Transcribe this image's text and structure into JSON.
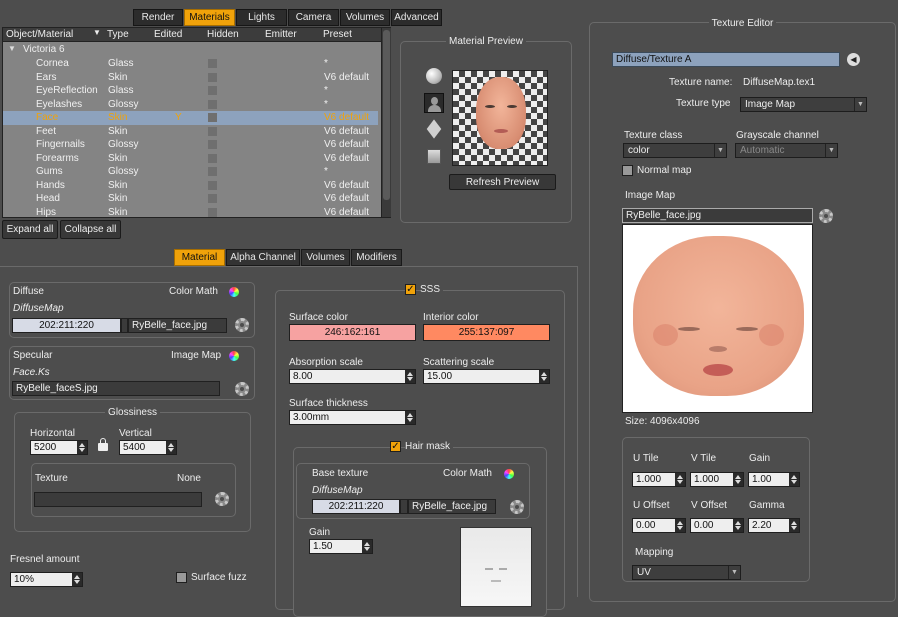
{
  "top_tabs": [
    "Render",
    "Materials",
    "Lights",
    "Camera",
    "Volumes",
    "Advanced"
  ],
  "active_top_tab": "Materials",
  "table": {
    "headers": [
      "Object/Material",
      "Type",
      "Edited",
      "Hidden",
      "Emitter",
      "Preset"
    ],
    "group": "Victoria 6",
    "rows": [
      {
        "name": "Cornea",
        "type": "Glass",
        "edited": "",
        "preset": "*"
      },
      {
        "name": "Ears",
        "type": "Skin",
        "edited": "",
        "preset": "V6 default"
      },
      {
        "name": "EyeReflection",
        "type": "Glass",
        "edited": "",
        "preset": "*"
      },
      {
        "name": "Eyelashes",
        "type": "Glossy",
        "edited": "",
        "preset": "*"
      },
      {
        "name": "Face",
        "type": "Skin",
        "edited": "Y",
        "preset": "V6 default",
        "selected": true
      },
      {
        "name": "Feet",
        "type": "Skin",
        "edited": "",
        "preset": "V6 default"
      },
      {
        "name": "Fingernails",
        "type": "Glossy",
        "edited": "",
        "preset": "V6 default"
      },
      {
        "name": "Forearms",
        "type": "Skin",
        "edited": "",
        "preset": "V6 default"
      },
      {
        "name": "Gums",
        "type": "Glossy",
        "edited": "",
        "preset": "*"
      },
      {
        "name": "Hands",
        "type": "Skin",
        "edited": "",
        "preset": "V6 default"
      },
      {
        "name": "Head",
        "type": "Skin",
        "edited": "",
        "preset": "V6 default"
      },
      {
        "name": "Hips",
        "type": "Skin",
        "edited": "",
        "preset": "V6 default"
      }
    ]
  },
  "expand_all": "Expand all",
  "collapse_all": "Collapse all",
  "preview": {
    "title": "Material Preview",
    "refresh": "Refresh Preview"
  },
  "sub_tabs": [
    "Material",
    "Alpha Channel",
    "Volumes",
    "Modifiers"
  ],
  "active_sub_tab": "Material",
  "diffuse": {
    "title": "Diffuse",
    "mode": "Color Math",
    "map": "DiffuseMap",
    "color": "202:211:220",
    "texture": "RyBelle_face.jpg"
  },
  "specular": {
    "title": "Specular",
    "mode": "Image Map",
    "map": "Face.Ks",
    "texture": "RyBelle_faceS.jpg"
  },
  "glossiness": {
    "title": "Glossiness",
    "horizontal_label": "Horizontal",
    "horizontal": "5200",
    "vertical_label": "Vertical",
    "vertical": "5400",
    "texture_label": "Texture",
    "texture_value": "None"
  },
  "fresnel": {
    "label": "Fresnel amount",
    "value": "10%"
  },
  "surface_fuzz": "Surface fuzz",
  "sss": {
    "label": "SSS",
    "surface_color_label": "Surface color",
    "surface_color": "246:162:161",
    "interior_color_label": "Interior color",
    "interior_color": "255:137:097",
    "absorption_label": "Absorption scale",
    "absorption": "8.00",
    "scattering_label": "Scattering scale",
    "scattering": "15.00",
    "thickness_label": "Surface thickness",
    "thickness": "3.00mm"
  },
  "hair_mask": {
    "label": "Hair mask",
    "base_label": "Base texture",
    "mode": "Color Math",
    "map": "DiffuseMap",
    "color": "202:211:220",
    "texture": "RyBelle_face.jpg",
    "gain_label": "Gain",
    "gain": "1.50"
  },
  "texture_editor": {
    "title": "Texture Editor",
    "path": "Diffuse/Texture A",
    "name_label": "Texture name:",
    "name": "DiffuseMap.tex1",
    "type_label": "Texture type",
    "type": "Image Map",
    "class_label": "Texture class",
    "class": "color",
    "grayscale_label": "Grayscale channel",
    "grayscale": "Automatic",
    "normal_map": "Normal map",
    "image_map_label": "Image Map",
    "image_file": "RyBelle_face.jpg",
    "size": "Size: 4096x4096",
    "utile_label": "U Tile",
    "utile": "1.000",
    "vtile_label": "V Tile",
    "vtile": "1.000",
    "gain_label": "Gain",
    "gain": "1.00",
    "uoffset_label": "U Offset",
    "uoffset": "0.00",
    "voffset_label": "V Offset",
    "voffset": "0.00",
    "gamma_label": "Gamma",
    "gamma": "2.20",
    "mapping_label": "Mapping",
    "mapping": "UV"
  },
  "colors": {
    "accent": "#f0a20a",
    "selected_row": "#8da2bd",
    "surface_color": "#f6a2a1",
    "interior_color": "#ff8961",
    "diffuse_color": "#cad3dc"
  }
}
